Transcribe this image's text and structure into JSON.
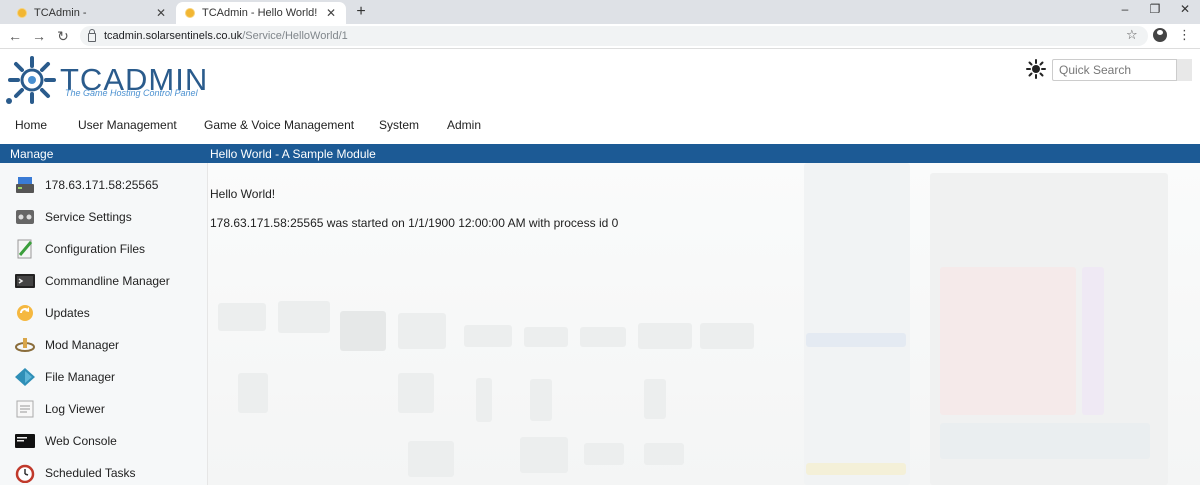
{
  "browser": {
    "tabs": [
      {
        "title": "TCAdmin -",
        "active": false
      },
      {
        "title": "TCAdmin - Hello World!",
        "active": true
      }
    ],
    "new_tab": "+",
    "window_controls": {
      "minimize": "–",
      "restore": "❐",
      "close": "✕"
    },
    "nav": {
      "back": "←",
      "forward": "→",
      "reload": "↻"
    },
    "url_host": "tcadmin.solarsentinels.co.uk",
    "url_path": "/Service/HelloWorld/1",
    "star_icon": "☆",
    "menu_icon": "⋮",
    "tab_close": "✕"
  },
  "brand": {
    "title": "TCADMIN",
    "subtitle": "The Game Hosting Control Panel",
    "color": "#2a5b8c"
  },
  "header": {
    "search_placeholder": "Quick Search"
  },
  "nav": {
    "items": [
      "Home",
      "User Management",
      "Game & Voice Management",
      "System",
      "Admin"
    ]
  },
  "titlebar": {
    "left": "Manage",
    "right": "Hello World - A Sample Module",
    "color": "#1c5a95"
  },
  "sidebar": {
    "items": [
      {
        "label": "178.63.171.58:25565",
        "icon": "server-icon"
      },
      {
        "label": "Service Settings",
        "icon": "settings-panel-icon"
      },
      {
        "label": "Configuration Files",
        "icon": "config-file-icon"
      },
      {
        "label": "Commandline Manager",
        "icon": "terminal-icon"
      },
      {
        "label": "Updates",
        "icon": "updates-icon"
      },
      {
        "label": "Mod Manager",
        "icon": "mod-manager-icon"
      },
      {
        "label": "File Manager",
        "icon": "file-manager-icon"
      },
      {
        "label": "Log Viewer",
        "icon": "log-viewer-icon"
      },
      {
        "label": "Web Console",
        "icon": "web-console-icon"
      },
      {
        "label": "Scheduled Tasks",
        "icon": "scheduled-tasks-icon"
      }
    ]
  },
  "main": {
    "line1": "Hello World!",
    "line2": "178.63.171.58:25565 was started on 1/1/1900 12:00:00 AM with process id 0"
  }
}
